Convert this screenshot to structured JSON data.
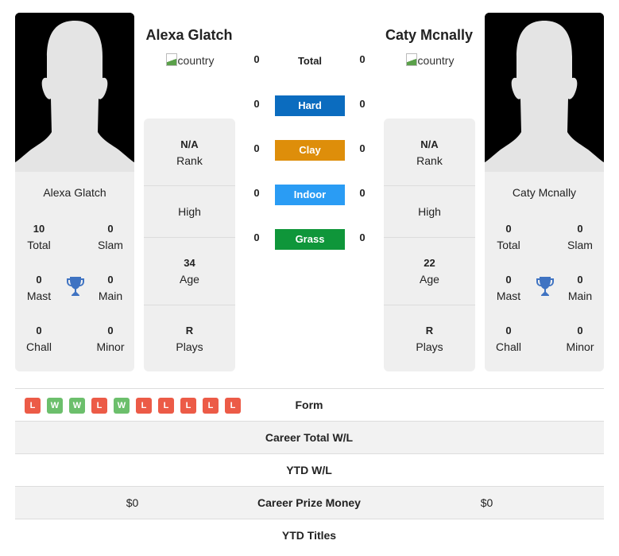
{
  "players": [
    {
      "name": "Alexa Glatch",
      "country_alt": "country",
      "card_name": "Alexa Glatch",
      "titles": {
        "total": {
          "value": "10",
          "label": "Total"
        },
        "slam": {
          "value": "0",
          "label": "Slam"
        },
        "mast": {
          "value": "0",
          "label": "Mast"
        },
        "main": {
          "value": "0",
          "label": "Main"
        },
        "chall": {
          "value": "0",
          "label": "Chall"
        },
        "minor": {
          "value": "0",
          "label": "Minor"
        }
      },
      "info": {
        "rank": {
          "value": "N/A",
          "label": "Rank"
        },
        "high": {
          "value": "",
          "label": "High"
        },
        "age": {
          "value": "34",
          "label": "Age"
        },
        "plays": {
          "value": "R",
          "label": "Plays"
        }
      }
    },
    {
      "name": "Caty Mcnally",
      "country_alt": "country",
      "card_name": "Caty Mcnally",
      "titles": {
        "total": {
          "value": "0",
          "label": "Total"
        },
        "slam": {
          "value": "0",
          "label": "Slam"
        },
        "mast": {
          "value": "0",
          "label": "Mast"
        },
        "main": {
          "value": "0",
          "label": "Main"
        },
        "chall": {
          "value": "0",
          "label": "Chall"
        },
        "minor": {
          "value": "0",
          "label": "Minor"
        }
      },
      "info": {
        "rank": {
          "value": "N/A",
          "label": "Rank"
        },
        "high": {
          "value": "",
          "label": "High"
        },
        "age": {
          "value": "22",
          "label": "Age"
        },
        "plays": {
          "value": "R",
          "label": "Plays"
        }
      }
    }
  ],
  "h2h": {
    "total": {
      "label": "Total",
      "left": "0",
      "right": "0"
    },
    "surfaces": [
      {
        "label": "Hard",
        "left": "0",
        "right": "0",
        "color": "#0b6cbf"
      },
      {
        "label": "Clay",
        "left": "0",
        "right": "0",
        "color": "#de8e0a"
      },
      {
        "label": "Indoor",
        "left": "0",
        "right": "0",
        "color": "#2a9cf4"
      },
      {
        "label": "Grass",
        "left": "0",
        "right": "0",
        "color": "#0f963a"
      }
    ]
  },
  "table": {
    "form": {
      "label": "Form",
      "left_results": [
        "L",
        "W",
        "W",
        "L",
        "W",
        "L",
        "L",
        "L",
        "L",
        "L"
      ]
    },
    "rows": [
      {
        "label": "Career Total W/L",
        "left": "",
        "right": ""
      },
      {
        "label": "YTD W/L",
        "left": "",
        "right": ""
      },
      {
        "label": "Career Prize Money",
        "left": "$0",
        "right": "$0"
      },
      {
        "label": "YTD Titles",
        "left": "",
        "right": ""
      }
    ]
  },
  "colors": {
    "win": "#6cbf6c",
    "loss": "#ec5b47",
    "trophy": "#3f73c2"
  }
}
